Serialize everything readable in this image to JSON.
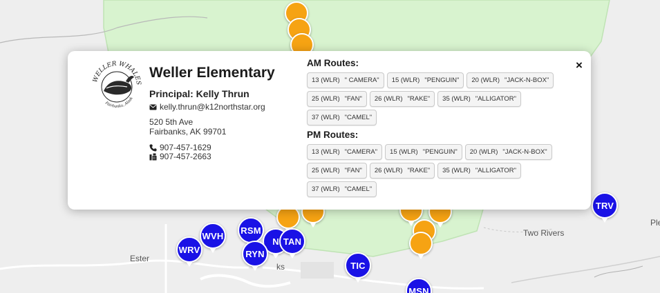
{
  "map": {
    "place_labels": [
      "Ester",
      "Two Rivers",
      "Ple",
      "ks"
    ],
    "colors": {
      "zone_fill": "#d8f3cf",
      "zone_border": "#bfe3b4",
      "school_marker": "#1a12e6",
      "bus_marker": "#f6a313"
    },
    "school_markers": [
      "TRV",
      "WVH",
      "RSM",
      "WRV",
      "N",
      "TAN",
      "RYN",
      "TIC",
      "MSN"
    ]
  },
  "popup": {
    "close_label": "×",
    "logo": {
      "alt": "Weller Whales logo",
      "text_top": "WELLER WHALES",
      "text_bottom": "Fairbanks, Alaska"
    },
    "school_name": "Weller Elementary",
    "principal": "Principal: Kelly Thrun",
    "email": "kelly.thrun@k12northstar.org",
    "address_line1": "520 5th Ave",
    "address_line2": "Fairbanks, AK 99701",
    "phone": "907-457-1629",
    "fax": "907-457-2663",
    "am_heading": "AM Routes:",
    "pm_heading": "PM Routes:",
    "am_routes": [
      {
        "num": "13 (WLR)",
        "name": "\" CAMERA\""
      },
      {
        "num": "15 (WLR)",
        "name": "\"PENGUIN\""
      },
      {
        "num": "20 (WLR)",
        "name": "\"JACK-N-BOX\""
      },
      {
        "num": "25 (WLR)",
        "name": "\"FAN\""
      },
      {
        "num": "26 (WLR)",
        "name": "\"RAKE\""
      },
      {
        "num": "35 (WLR)",
        "name": "\"ALLIGATOR\""
      },
      {
        "num": "37 (WLR)",
        "name": "\"CAMEL\""
      }
    ],
    "pm_routes": [
      {
        "num": "13 (WLR)",
        "name": "\"CAMERA\""
      },
      {
        "num": "15 (WLR)",
        "name": "\"PENGUIN\""
      },
      {
        "num": "20 (WLR)",
        "name": "\"JACK-N-BOX\""
      },
      {
        "num": "25 (WLR)",
        "name": "\"FAN\""
      },
      {
        "num": "26 (WLR)",
        "name": "\"RAKE\""
      },
      {
        "num": "35 (WLR)",
        "name": "\"ALLIGATOR\""
      },
      {
        "num": "37 (WLR)",
        "name": "\"CAMEL\""
      }
    ]
  }
}
